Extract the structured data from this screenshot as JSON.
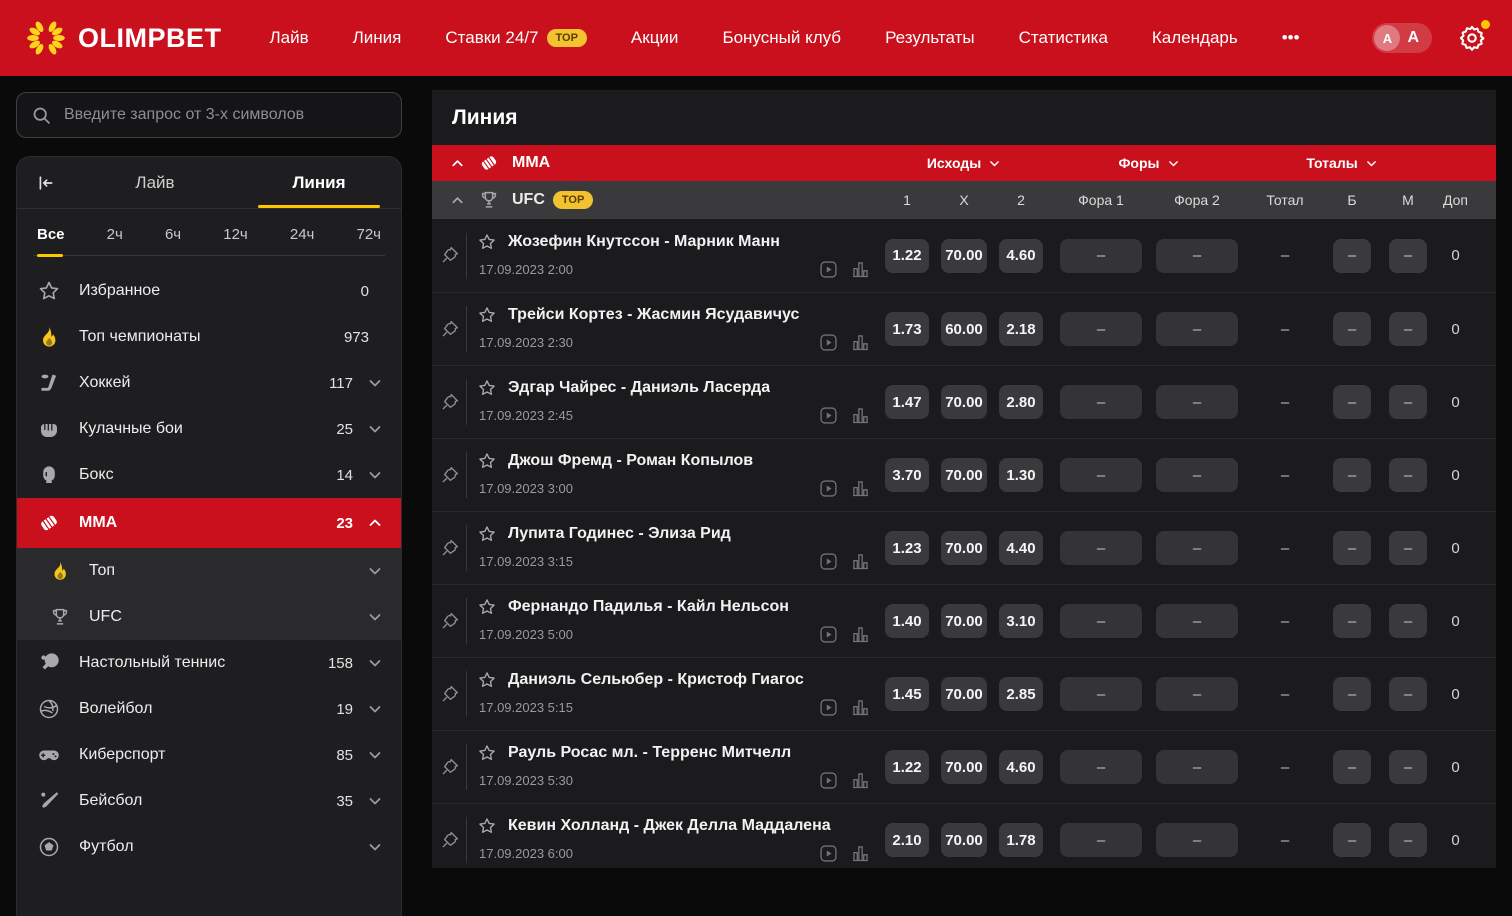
{
  "brand": {
    "name": "OLIMPBET"
  },
  "colors": {
    "accent_red": "#C9101C",
    "accent_yellow": "#F5C71A",
    "underline_yellow": "#FFC700"
  },
  "nav": {
    "items": [
      {
        "label": "Лайв"
      },
      {
        "label": "Линия"
      },
      {
        "label": "Ставки 24/7",
        "badge": "TOP"
      },
      {
        "label": "Акции"
      },
      {
        "label": "Бонусный клуб"
      },
      {
        "label": "Результаты"
      },
      {
        "label": "Статистика"
      },
      {
        "label": "Календарь"
      },
      {
        "label": "•••"
      }
    ],
    "font_small": "A",
    "font_large": "A"
  },
  "sidebar": {
    "search_placeholder": "Введите запрос от 3-х символов",
    "tabs": [
      "Лайв",
      "Линия"
    ],
    "active_tab": "Линия",
    "time_filters": [
      {
        "label": "Все",
        "active": true
      },
      {
        "label": "2ч"
      },
      {
        "label": "6ч"
      },
      {
        "label": "12ч"
      },
      {
        "label": "24ч"
      },
      {
        "label": "72ч"
      }
    ],
    "items": [
      {
        "icon": "star",
        "label": "Избранное",
        "count": "0"
      },
      {
        "icon": "flame",
        "label": "Топ чемпионаты",
        "count": "973"
      },
      {
        "icon": "hockey",
        "label": "Хоккей",
        "count": "117",
        "chevron": "down"
      },
      {
        "icon": "fist",
        "label": "Кулачные бои",
        "count": "25",
        "chevron": "down"
      },
      {
        "icon": "boxing-glove",
        "label": "Бокс",
        "count": "14",
        "chevron": "down"
      },
      {
        "icon": "mma-glove",
        "label": "ММА",
        "count": "23",
        "chevron": "up",
        "selected": true
      },
      {
        "icon": "flame",
        "label": "Топ",
        "chevron": "down",
        "sub": true
      },
      {
        "icon": "trophy",
        "label": "UFC",
        "chevron": "down",
        "sub": true
      },
      {
        "icon": "table-tennis",
        "label": "Настольный теннис",
        "count": "158",
        "chevron": "down"
      },
      {
        "icon": "volleyball",
        "label": "Волейбол",
        "count": "19",
        "chevron": "down"
      },
      {
        "icon": "gamepad",
        "label": "Киберспорт",
        "count": "85",
        "chevron": "down"
      },
      {
        "icon": "baseball",
        "label": "Бейсбол",
        "count": "35",
        "chevron": "down"
      },
      {
        "icon": "soccer-ball",
        "label": "Футбол",
        "chevron": "down",
        "partial": true
      }
    ]
  },
  "main": {
    "title": "Линия",
    "section": {
      "label": "ММА",
      "groups": [
        "Исходы",
        "Форы",
        "Тоталы"
      ]
    },
    "league": {
      "label": "UFC",
      "badge": "TOP",
      "columns": [
        "1",
        "X",
        "2",
        "Фора 1",
        "Фора 2",
        "Тотал",
        "Б",
        "М",
        "Доп"
      ]
    },
    "matches": [
      {
        "name": "Жозефин Кнутссон - Марник Манн",
        "date": "17.09.2023 2:00",
        "k1": "1.22",
        "kx": "70.00",
        "k2": "4.60",
        "f1": "–",
        "f2": "–",
        "total": "–",
        "b": "–",
        "m": "–",
        "dop": "0"
      },
      {
        "name": "Трейси Кортез - Жасмин Ясудавичус",
        "date": "17.09.2023 2:30",
        "k1": "1.73",
        "kx": "60.00",
        "k2": "2.18",
        "f1": "–",
        "f2": "–",
        "total": "–",
        "b": "–",
        "m": "–",
        "dop": "0"
      },
      {
        "name": "Эдгар Чайрес - Даниэль Ласерда",
        "date": "17.09.2023 2:45",
        "k1": "1.47",
        "kx": "70.00",
        "k2": "2.80",
        "f1": "–",
        "f2": "–",
        "total": "–",
        "b": "–",
        "m": "–",
        "dop": "0"
      },
      {
        "name": "Джош Фремд - Роман Копылов",
        "date": "17.09.2023 3:00",
        "k1": "3.70",
        "kx": "70.00",
        "k2": "1.30",
        "f1": "–",
        "f2": "–",
        "total": "–",
        "b": "–",
        "m": "–",
        "dop": "0"
      },
      {
        "name": "Лупита Годинес - Элиза Рид",
        "date": "17.09.2023 3:15",
        "k1": "1.23",
        "kx": "70.00",
        "k2": "4.40",
        "f1": "–",
        "f2": "–",
        "total": "–",
        "b": "–",
        "m": "–",
        "dop": "0"
      },
      {
        "name": "Фернандо Падилья - Кайл Нельсон",
        "date": "17.09.2023 5:00",
        "k1": "1.40",
        "kx": "70.00",
        "k2": "3.10",
        "f1": "–",
        "f2": "–",
        "total": "–",
        "b": "–",
        "m": "–",
        "dop": "0"
      },
      {
        "name": "Даниэль Сельюбер - Кристоф Гиагос",
        "date": "17.09.2023 5:15",
        "k1": "1.45",
        "kx": "70.00",
        "k2": "2.85",
        "f1": "–",
        "f2": "–",
        "total": "–",
        "b": "–",
        "m": "–",
        "dop": "0"
      },
      {
        "name": "Рауль Росас мл. - Терренс Митчелл",
        "date": "17.09.2023 5:30",
        "k1": "1.22",
        "kx": "70.00",
        "k2": "4.60",
        "f1": "–",
        "f2": "–",
        "total": "–",
        "b": "–",
        "m": "–",
        "dop": "0"
      },
      {
        "name": "Кевин Холланд - Джек Делла Маддалена",
        "date": "17.09.2023 6:00",
        "k1": "2.10",
        "kx": "70.00",
        "k2": "1.78",
        "f1": "–",
        "f2": "–",
        "total": "–",
        "b": "–",
        "m": "–",
        "dop": "0"
      }
    ]
  }
}
